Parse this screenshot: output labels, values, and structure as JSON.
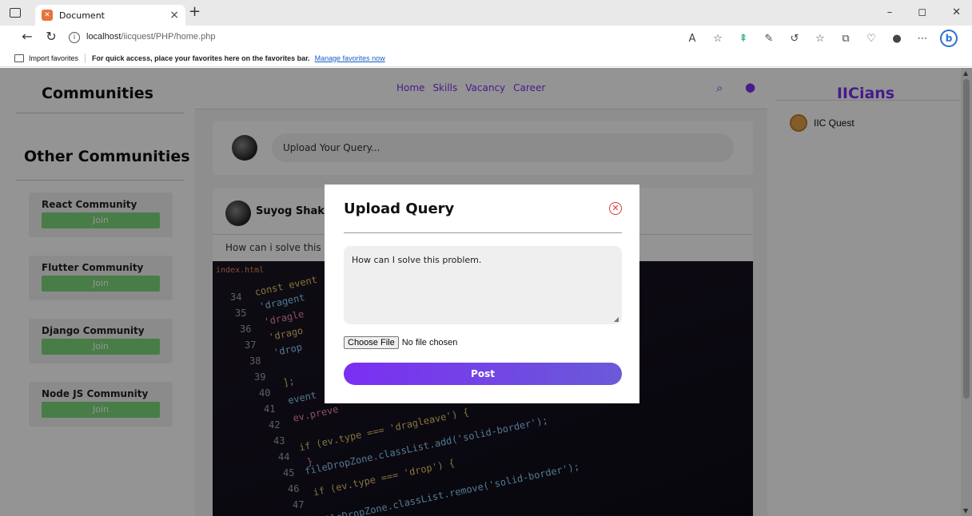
{
  "browser": {
    "tab_title": "Document",
    "tab_close": "×",
    "new_tab": "+",
    "url_host": "localhost",
    "url_path": "/iicquest/PHP/home.php",
    "window_minimize": "–",
    "window_restore": "◻",
    "window_close": "✕",
    "favorites_import": "Import favorites",
    "favorites_hint": "For quick access, place your favorites here on the favorites bar.",
    "favorites_manage": "Manage favorites now"
  },
  "left_sidebar": {
    "title": "Communities",
    "other_title": "Other Communities",
    "communities": [
      {
        "name": "React Community",
        "join": "Join"
      },
      {
        "name": "Flutter Community",
        "join": "Join"
      },
      {
        "name": "Django Community",
        "join": "Join"
      },
      {
        "name": "Node JS Community",
        "join": "Join"
      }
    ]
  },
  "topnav": {
    "links": [
      "Home",
      "Skills",
      "Vacancy",
      "Career"
    ]
  },
  "upload_card": {
    "placeholder": "Upload Your Query..."
  },
  "post": {
    "author": "Suyog Shaky",
    "text": "How can i solve this"
  },
  "code_image": {
    "tab": "index.html",
    "line_numbers": [
      "34",
      "35",
      "36",
      "37",
      "38",
      "39",
      "40",
      "41",
      "42",
      "43",
      "44",
      "45",
      "46",
      "47"
    ],
    "lines": [
      "const event",
      "'dragent",
      "'dragle",
      "'drago",
      "'drop",
      "",
      "];",
      "event",
      "ev.preve",
      "if (ev.type === 'dragleave') {",
      "fileDropZone.classList.add('solid-border');",
      "}",
      "if (ev.type === 'drop') {",
      "fileDropZone.classList.remove('solid-border');"
    ]
  },
  "right_sidebar": {
    "title": "IICians",
    "members": [
      {
        "name": "IIC Quest"
      }
    ]
  },
  "modal": {
    "title": "Upload Query",
    "textarea_value": "How can I solve this problem.",
    "choose_file": "Choose File",
    "no_file": "No file chosen",
    "post_button": "Post"
  },
  "colors": {
    "accent": "#7b2ff2",
    "join_green": "#7dd87d",
    "close_red": "#e0343a"
  }
}
